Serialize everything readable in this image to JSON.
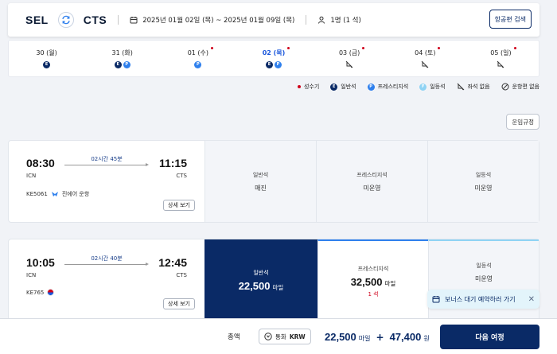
{
  "search": {
    "origin": "SEL",
    "destination": "CTS",
    "dates": "2025년 01월 02일 (목) ~ 2025년 01월 09일 (목)",
    "passengers": "1명 (1 석)",
    "search_button": "항공편 검색"
  },
  "date_strip": [
    {
      "label": "30 (월)",
      "peak": false,
      "selected": false,
      "badges": [
        "E"
      ]
    },
    {
      "label": "31 (화)",
      "peak": false,
      "selected": false,
      "badges": [
        "E",
        "P"
      ]
    },
    {
      "label": "01 (수)",
      "peak": true,
      "selected": false,
      "badges": [
        "P"
      ]
    },
    {
      "label": "02 (목)",
      "peak": true,
      "selected": true,
      "badges": [
        "E",
        "P"
      ]
    },
    {
      "label": "03 (금)",
      "peak": true,
      "selected": false,
      "badges": [
        "none"
      ]
    },
    {
      "label": "04 (토)",
      "peak": true,
      "selected": false,
      "badges": [
        "none"
      ]
    },
    {
      "label": "05 (일)",
      "peak": true,
      "selected": false,
      "badges": [
        "none"
      ]
    }
  ],
  "legend": {
    "peak": "성수기",
    "economy": "일반석",
    "prestige": "프레스티지석",
    "first": "일등석",
    "no_seat": "좌석 없음",
    "no_flight": "운항편 없음"
  },
  "fare_rule_button": "운임규정",
  "flights": [
    {
      "depart_time": "08:30",
      "depart_code": "ICN",
      "duration": "02시간 45분",
      "arrive_time": "11:15",
      "arrive_code": "CTS",
      "flight_no": "KE5061",
      "operator": "진에어 운항",
      "detail_button": "상세 보기",
      "cabins": [
        {
          "name": "일반석",
          "status": "매진"
        },
        {
          "name": "프레스티지석",
          "status": "미운영"
        },
        {
          "name": "일등석",
          "status": "미운영"
        }
      ]
    },
    {
      "depart_time": "10:05",
      "depart_code": "ICN",
      "duration": "02시간 40분",
      "arrive_time": "12:45",
      "arrive_code": "CTS",
      "flight_no": "KE765",
      "detail_button": "상세 보기",
      "cabins": [
        {
          "name": "일반석",
          "miles": "22,500",
          "unit": "마일"
        },
        {
          "name": "프레스티지석",
          "miles": "32,500",
          "unit": "마일",
          "seats": "1 석"
        },
        {
          "name": "일등석",
          "status": "미운영"
        }
      ]
    }
  ],
  "bonus_toast": "보너스 대기 예약하러 가기",
  "bottom": {
    "total_label": "총액",
    "currency_prefix": "통화",
    "currency": "KRW",
    "miles": "22,500",
    "miles_unit": "마일",
    "plus": "+",
    "won": "47,400",
    "won_unit": "원",
    "next_button": "다음 여정"
  },
  "colors": {
    "brand_navy": "#0a2a66",
    "prestige_blue": "#2f80ed",
    "first_light": "#8fd3f4",
    "peak_red": "#d0021b",
    "selected_date": "#1a56db"
  }
}
